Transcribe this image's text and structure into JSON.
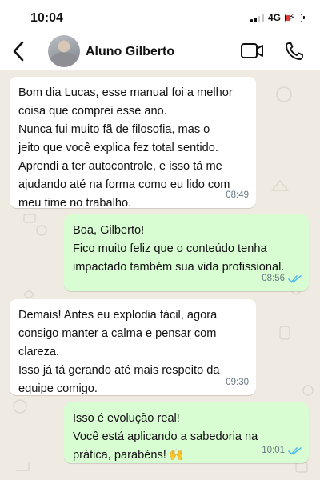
{
  "status_bar": {
    "time": "10:04",
    "network": "4G",
    "battery_level": 0.25,
    "battery_color": "#e53935"
  },
  "header": {
    "back_icon": "chevron-left-icon",
    "contact_name": "Aluno Gilberto",
    "video_icon": "video-camera-icon",
    "call_icon": "phone-icon"
  },
  "colors": {
    "chat_background": "#efeae2",
    "incoming_bubble": "#ffffff",
    "outgoing_bubble": "#d9fdd3",
    "read_ticks": "#53bdeb",
    "timestamp": "#667781"
  },
  "messages": [
    {
      "direction": "incoming",
      "text": "Bom dia Lucas, esse manual foi a melhor\ncoisa que comprei esse ano.\nNunca fui muito fã de filosofia, mas o\njeito que você explica fez total sentido.\nAprendi a ter autocontrole, e isso tá me\najudando até na forma como eu lido com\nmeu time no trabalho.",
      "time": "08:49"
    },
    {
      "direction": "outgoing",
      "text": "Boa, Gilberto!\nFico muito feliz que o conteúdo tenha\nimpactado também sua vida profissional.",
      "time": "08:56",
      "status": "read"
    },
    {
      "direction": "incoming",
      "text": "Demais! Antes eu explodia fácil, agora\nconsigo manter a calma e pensar com\nclareza.\nIsso já tá gerando até mais respeito da\nequipe comigo.",
      "time": "09:30"
    },
    {
      "direction": "outgoing",
      "text": "Isso é evolução real!\nVocê está aplicando a sabedoria na\nprática, parabéns! 🙌",
      "time": "10:01",
      "status": "read"
    }
  ]
}
